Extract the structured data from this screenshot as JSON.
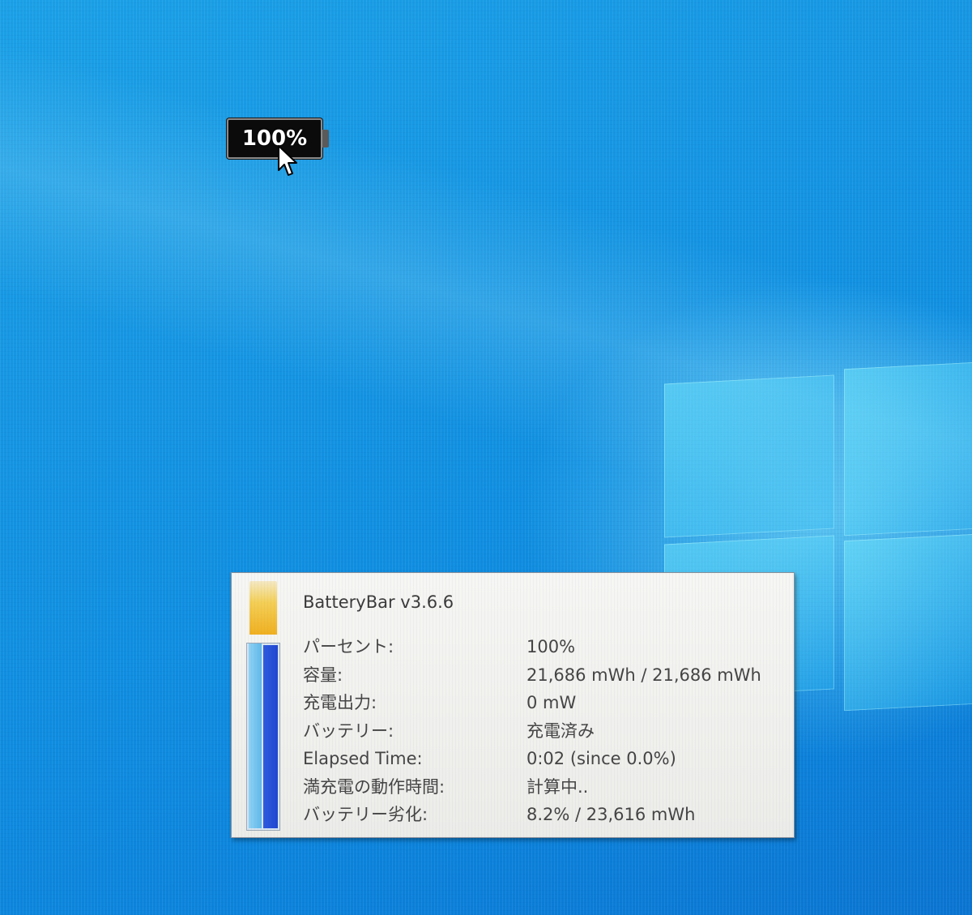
{
  "battery_widget": {
    "percent_text": "100%",
    "charge_fraction": 1.0
  },
  "tooltip": {
    "title": "BatteryBar v3.6.6",
    "rows": [
      {
        "label": "パーセント:",
        "value": "100%"
      },
      {
        "label": "容量:",
        "value": "21,686 mWh / 21,686 mWh"
      },
      {
        "label": "充電出力:",
        "value": "0 mW"
      },
      {
        "label": "バッテリー:",
        "value": "充電済み"
      },
      {
        "label": "Elapsed Time:",
        "value": "0:02 (since 0.0%)"
      },
      {
        "label": "満充電の動作時間:",
        "value": "計算中.."
      },
      {
        "label": "バッテリー劣化:",
        "value": "8.2% / 23,616 mWh"
      }
    ],
    "meter": {
      "current_fraction": 1.0,
      "design_fraction": 1.0
    }
  },
  "icons": {
    "cursor": "mouse-pointer-icon",
    "windows_logo": "windows-logo-icon"
  },
  "colors": {
    "desktop_blue": "#0f8ee0",
    "battery_fill": "#0b0b0b",
    "meter_blue": "#1f46d0",
    "meter_light_blue": "#8fd3f5",
    "meter_indicator": "#f4cf55"
  }
}
